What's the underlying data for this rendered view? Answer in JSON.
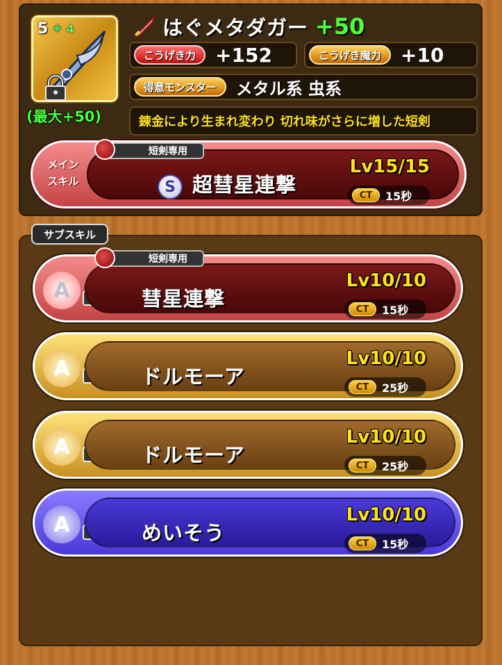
{
  "weapon": {
    "rarity": "5",
    "star_icon": "✦",
    "star_count": "4",
    "max_bonus": "(最大+50)",
    "name": "はぐメタダガー",
    "plus": "+50",
    "description": "錬金により生まれ変わり 切れ味がさらに増した短剣"
  },
  "stats": {
    "attack_label": "こうげき力",
    "attack_value": "+152",
    "magic_label": "こうげき魔力",
    "magic_value": "+10",
    "monster_label": "得意モンスター",
    "monster_value": "メタル系 虫系"
  },
  "main_skill": {
    "section_label_line1": "メイン",
    "section_label_line2": "スキル",
    "tag": "短剣専用",
    "rank": "S",
    "name": "超彗星連撃",
    "level": "Lv15/15",
    "ct_label": "CT",
    "ct_value": "15秒"
  },
  "sub_skill_label": "サブスキル",
  "sub_skills": [
    {
      "badge": "A",
      "icon": "A",
      "tag": "短剣専用",
      "name": "彗星連撃",
      "level": "Lv10/10",
      "ct_label": "CT",
      "ct_value": "15秒"
    },
    {
      "badge": "A",
      "icon": "A",
      "name": "ドルモーア",
      "level": "Lv10/10",
      "ct_label": "CT",
      "ct_value": "25秒"
    },
    {
      "badge": "A",
      "icon": "A",
      "name": "ドルモーア",
      "level": "Lv10/10",
      "ct_label": "CT",
      "ct_value": "25秒"
    },
    {
      "badge": "A",
      "icon": "A",
      "name": "めいそう",
      "level": "Lv10/10",
      "ct_label": "CT",
      "ct_value": "15秒"
    }
  ]
}
